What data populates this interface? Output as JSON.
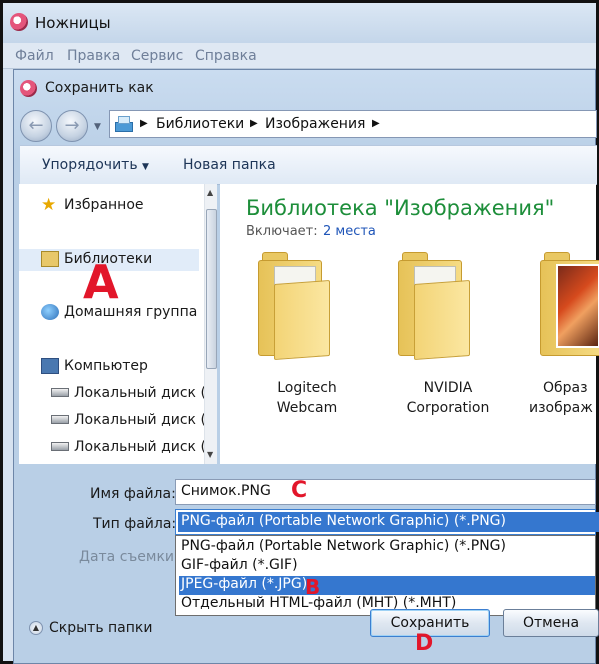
{
  "app": {
    "title": "Ножницы"
  },
  "menubar": [
    "Файл",
    "Правка",
    "Сервис",
    "Справка"
  ],
  "dialog": {
    "title": "Сохранить как",
    "address": [
      "Библиотеки",
      "Изображения"
    ],
    "toolbar": {
      "organize": "Упорядочить",
      "new_folder": "Новая папка"
    }
  },
  "nav_pane": {
    "items": [
      {
        "label": "Избранное",
        "icon": "star-icon"
      },
      {
        "label": "Библиотеки",
        "icon": "libraries-icon",
        "selected": true
      },
      {
        "label": "Домашняя группа",
        "icon": "homegroup-icon"
      },
      {
        "label": "Компьютер",
        "icon": "computer-icon"
      },
      {
        "label": "Локальный диск (",
        "icon": "disk-icon"
      },
      {
        "label": "Локальный диск (",
        "icon": "disk-icon"
      },
      {
        "label": "Локальный диск (",
        "icon": "disk-icon"
      }
    ]
  },
  "library": {
    "title": "Библиотека \"Изображения\"",
    "includes_label": "Включает:",
    "includes_link": "2 места",
    "folders": [
      {
        "line1": "Logitech",
        "line2": "Webcam"
      },
      {
        "line1": "NVIDIA",
        "line2": "Corporation"
      },
      {
        "line1": "Образ",
        "line2": "изображ"
      }
    ]
  },
  "form": {
    "filename_label": "Имя файла:",
    "filename_value": "Снимок.PNG",
    "filetype_label": "Тип файла:",
    "filetype_value": "PNG-файл (Portable Network Graphic) (*.PNG)",
    "date_label": "Дата съемки:",
    "filetype_options": [
      "PNG-файл (Portable Network Graphic) (*.PNG)",
      "GIF-файл (*.GIF)",
      "JPEG-файл (*.JPG)",
      "Отдельный HTML-файл (MHT) (*.MHT)"
    ],
    "highlighted_option_index": 2
  },
  "footer": {
    "hide_folders": "Скрыть папки",
    "save": "Сохранить",
    "cancel": "Отмена"
  },
  "annotations": {
    "a": "A",
    "b": "B",
    "c": "C",
    "d": "D",
    "color": "#e2162a"
  }
}
